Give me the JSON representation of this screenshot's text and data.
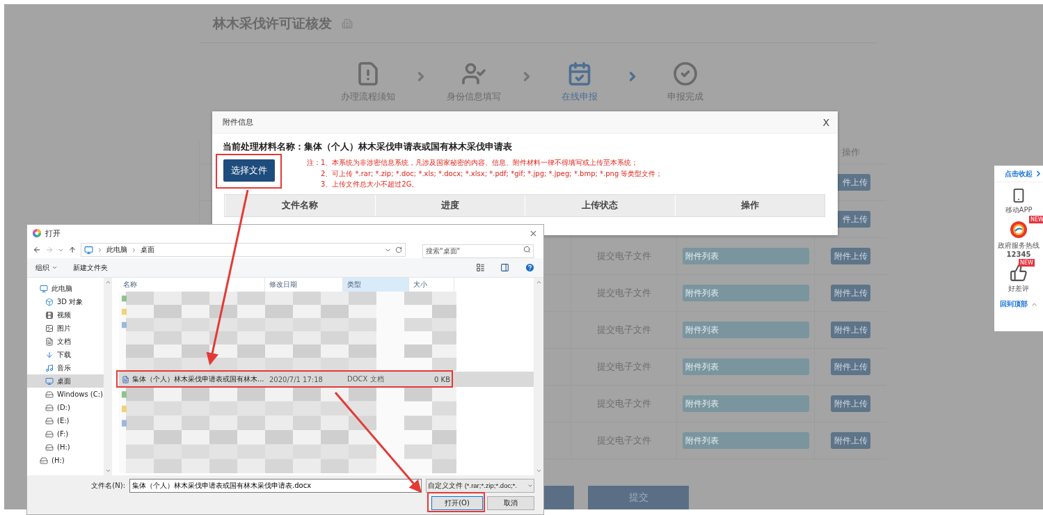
{
  "page": {
    "title": "林木采伐许可证核发",
    "steps": [
      {
        "label": "办理流程须知",
        "kind": "notice",
        "selected": false
      },
      {
        "label": "身份信息填写",
        "kind": "identity",
        "selected": false
      },
      {
        "label": "在线申报",
        "kind": "apply",
        "selected": true
      },
      {
        "label": "申报完成",
        "kind": "done",
        "selected": false
      }
    ],
    "table": {
      "columns": [
        {
          "label": "操作"
        }
      ],
      "rows": [
        {
          "button": "件上传"
        },
        {
          "button": "件上传"
        },
        {
          "type": "提交电子文件",
          "placeholder": "附件列表",
          "button": "附件上传"
        },
        {
          "type": "提交电子文件",
          "placeholder": "附件列表",
          "button": "附件上传"
        },
        {
          "type": "提交电子文件",
          "placeholder": "附件列表",
          "button": "附件上传"
        },
        {
          "type": "提交电子文件",
          "placeholder": "附件列表",
          "button": "附件上传"
        },
        {
          "type": "提交电子文件",
          "placeholder": "附件列表",
          "button": "附件上传"
        },
        {
          "type": "提交电子文件",
          "placeholder": "附件列表",
          "button": "附件上传"
        }
      ]
    },
    "footer_buttons": [
      {
        "kind": "unlabeled"
      },
      {
        "kind": "labeled",
        "label": "提交"
      }
    ]
  },
  "modal": {
    "title": "附件信息",
    "close": "X",
    "material": "当前处理材料名称：集体（个人）林木采伐申请表或国有林木采伐申请表",
    "choose_button": "选择文件",
    "notes": {
      "prefix": "注：",
      "lines": [
        "1、本系统为非涉密信息系统，凡涉及国家秘密的内容、信息、附件材料一律不得填写或上传至本系统；",
        "2、可上传 *.rar; *.zip; *.doc; *.xls; *.docx; *.xlsx; *.pdf; *gif; *.jpg; *.jpeg; *.bmp; *.png 等类型文件；",
        "3、上传文件总大小不超过2G。"
      ]
    },
    "columns": [
      "文件名称",
      "进度",
      "上传状态",
      "操作"
    ]
  },
  "dialog": {
    "title": "打开",
    "path": [
      "此电脑",
      "桌面"
    ],
    "search_placeholder": "搜索\"桌面\"",
    "toolbar": [
      {
        "label": "组织",
        "kind": "menu"
      },
      {
        "label": "新建文件夹",
        "kind": "button"
      }
    ],
    "tree": [
      {
        "label": "此电脑",
        "kind": "pc",
        "selected": false,
        "children": [
          {
            "label": "3D 对象",
            "kind": "cube",
            "selected": false
          },
          {
            "label": "视频",
            "kind": "video",
            "selected": false
          },
          {
            "label": "图片",
            "kind": "picture",
            "selected": false
          },
          {
            "label": "文档",
            "kind": "document",
            "selected": false
          },
          {
            "label": "下载",
            "kind": "download",
            "selected": false
          },
          {
            "label": "音乐",
            "kind": "music",
            "selected": false
          },
          {
            "label": "桌面",
            "kind": "desktop",
            "selected": true
          },
          {
            "label": "Windows (C:)",
            "kind": "drive",
            "selected": false
          },
          {
            "label": "(D:)",
            "kind": "drive",
            "selected": false
          },
          {
            "label": "(E:)",
            "kind": "drive",
            "selected": false
          },
          {
            "label": "(F:)",
            "kind": "drive",
            "selected": false
          },
          {
            "label": "(H:)",
            "kind": "drive",
            "selected": false
          }
        ]
      },
      {
        "label": "(H:)",
        "kind": "drive",
        "selected": false
      }
    ],
    "columns": [
      {
        "label": "名称",
        "selected": false
      },
      {
        "label": "修改日期",
        "selected": false
      },
      {
        "label": "类型",
        "selected": true
      },
      {
        "label": "大小",
        "selected": false
      }
    ],
    "files": [
      {
        "name": "集体（个人）林木采伐申请表或国有林木...",
        "modified": "2020/7/1 17:18",
        "type": "DOCX 文档",
        "size": "0 KB",
        "selected": true
      }
    ],
    "filename_label": "文件名(N):",
    "filename": "集体（个人）林木采伐申请表或国有林木采伐申请表.docx",
    "filter": "自定义文件 (*.rar;*.zip;*.doc;*.",
    "buttons": [
      {
        "label": "打开(O)",
        "kind": "primary"
      },
      {
        "label": "取消",
        "kind": "secondary"
      }
    ]
  },
  "side_panel": {
    "collapse": "点击收起",
    "items": [
      {
        "label": "移动APP",
        "kind": "phone"
      },
      {
        "label": "政府服务热线",
        "number": "12345",
        "kind": "hotline",
        "badge": "NEW"
      },
      {
        "label": "好差评",
        "kind": "rating",
        "badge": "NEW"
      }
    ],
    "back_to_top": "回到顶部"
  }
}
